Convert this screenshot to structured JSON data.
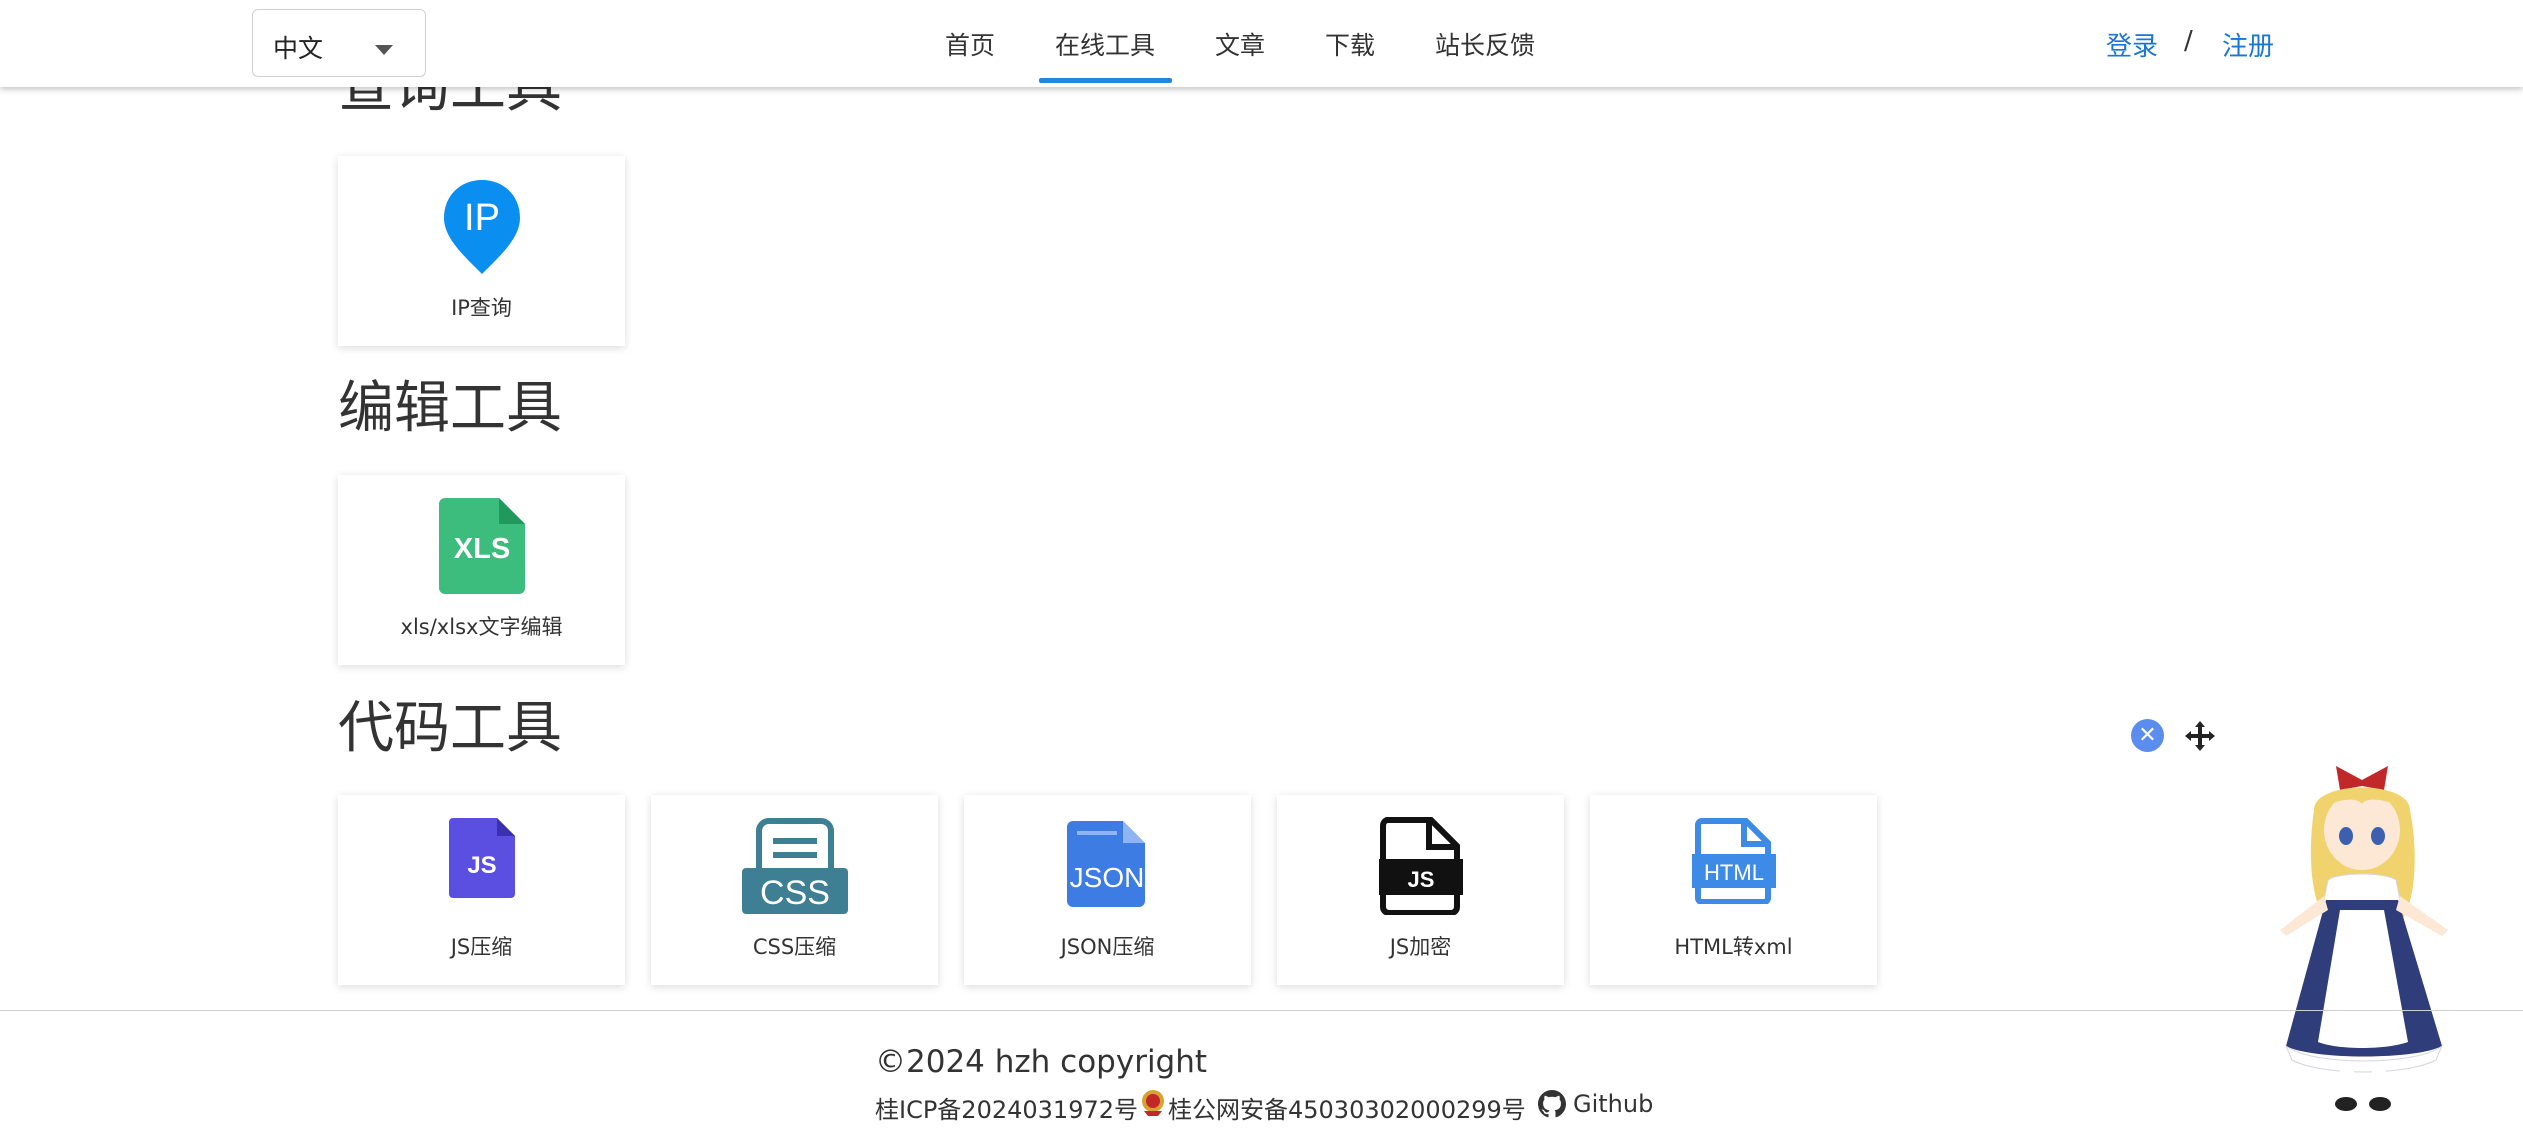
{
  "header": {
    "language": "中文",
    "nav": [
      "首页",
      "在线工具",
      "文章",
      "下载",
      "站长反馈"
    ],
    "active_nav": "在线工具",
    "login": "登录",
    "separator": "/",
    "register": "注册"
  },
  "sections": [
    {
      "title": "查询工具",
      "tools": [
        {
          "label": "IP查询",
          "icon": "ip-pin-icon"
        }
      ]
    },
    {
      "title": "编辑工具",
      "tools": [
        {
          "label": "xls/xlsx文字编辑",
          "icon": "xls-file-icon"
        }
      ]
    },
    {
      "title": "代码工具",
      "tools": [
        {
          "label": "JS压缩",
          "icon": "js-file-icon"
        },
        {
          "label": "CSS压缩",
          "icon": "css-file-icon"
        },
        {
          "label": "JSON压缩",
          "icon": "json-file-icon"
        },
        {
          "label": "JS加密",
          "icon": "js-encrypt-icon"
        },
        {
          "label": "HTML转xml",
          "icon": "html-file-icon"
        }
      ]
    }
  ],
  "icon_text": {
    "ip": "IP",
    "xls": "XLS",
    "js": "JS",
    "css": "CSS",
    "json": "JSON",
    "js2": "JS",
    "html": "HTML"
  },
  "footer": {
    "copyright": "©2024 hzh copyright",
    "icp": "桂ICP备2024031972号",
    "police": "桂公网安备45030302000299号",
    "github": "Github"
  },
  "colors": {
    "accent": "#1976d2",
    "ip_icon": "#0a8ff0",
    "xls_icon": "#3dbd7d",
    "js_icon": "#5a4fe0",
    "css_icon": "#3f7f94",
    "json_icon": "#3d7de3",
    "html_icon": "#3d8be6"
  }
}
